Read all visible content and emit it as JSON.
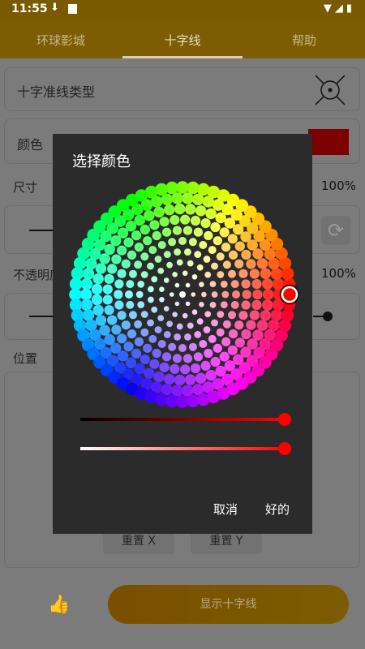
{
  "status": {
    "time": "11:55"
  },
  "tabs": [
    "环球影城",
    "十字线",
    "帮助"
  ],
  "settings": {
    "crosshair_type_label": "十字准线类型",
    "color_label": "颜色",
    "size_label": "尺寸",
    "size_value": "100%",
    "opacity_label": "不透明度",
    "opacity_value": "100%",
    "position_label": "位置",
    "reset_x": "重置 X",
    "reset_y": "重置 Y",
    "show_button": "显示十字线",
    "selected_color": "#ff0000"
  },
  "dialog": {
    "title": "选择颜色",
    "cancel": "取消",
    "ok": "好的",
    "selected_hue_deg": 0,
    "lightness_level": 1.0,
    "alpha_level": 1.0
  },
  "icons": {
    "download": "download-icon",
    "wifi": "wifi-icon",
    "battery": "battery-icon",
    "thumbs_up": "thumbs-up-icon",
    "refresh": "refresh-icon",
    "crosshair": "crosshair-icon"
  }
}
